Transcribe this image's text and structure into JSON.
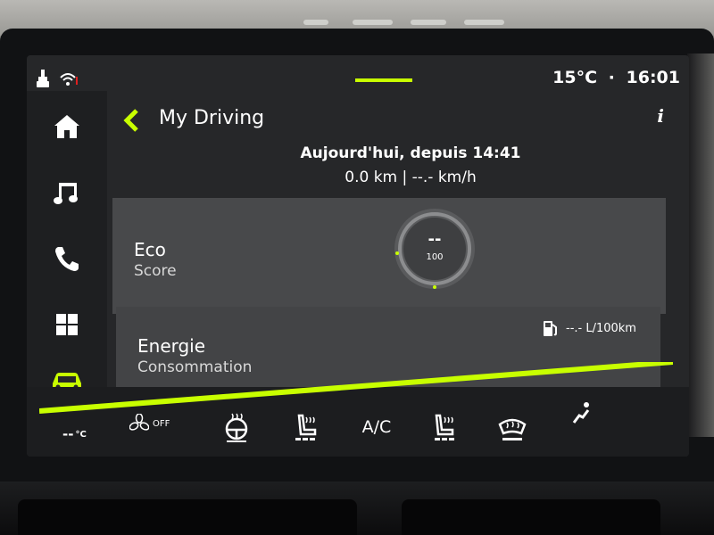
{
  "status": {
    "temperature": "15°C",
    "separator": "·",
    "time": "16:01"
  },
  "header": {
    "title": "My Driving",
    "info_label": "i"
  },
  "session": {
    "title": "Aujourd'hui, depuis 14:41",
    "stats": "0.0 km | --.- km/h"
  },
  "eco": {
    "title": "Eco",
    "subtitle": "Score",
    "value": "--",
    "max": "100"
  },
  "energy": {
    "title": "Energie",
    "subtitle": "Consommation",
    "value": "--.- L/100km"
  },
  "climate": {
    "temp_value": "--",
    "temp_unit": "°C",
    "fan_state": "OFF",
    "ac_label": "A/C"
  },
  "sidebar": {
    "items": [
      {
        "icon": "home-icon"
      },
      {
        "icon": "music-note-icon"
      },
      {
        "icon": "phone-icon"
      },
      {
        "icon": "apps-grid-icon"
      },
      {
        "icon": "car-icon",
        "active": true
      }
    ]
  },
  "colors": {
    "accent": "#c8ff00",
    "screen_bg": "#262729",
    "card_bg": "#48494b"
  }
}
